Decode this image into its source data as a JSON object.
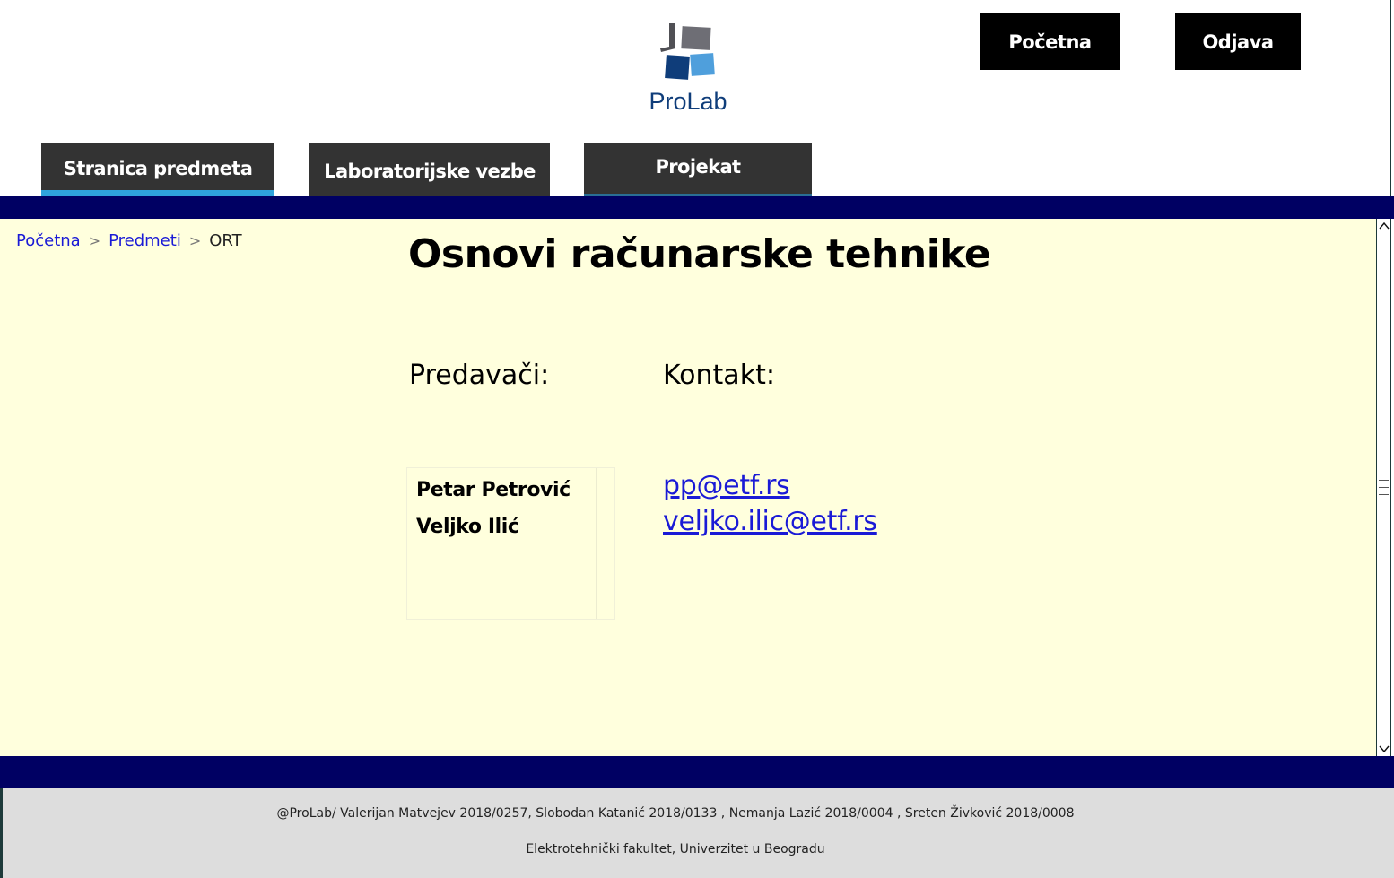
{
  "header": {
    "logo_text": "ProLab",
    "pocetna_button": "Početna",
    "odjava_button": "Odjava"
  },
  "tabs": [
    {
      "label": "Stranica predmeta",
      "active": true
    },
    {
      "label": "Laboratorijske vezbe",
      "active": false
    },
    {
      "label": "Projekat",
      "active": false
    }
  ],
  "breadcrumb": {
    "items": [
      "Početna",
      "Predmeti",
      "ORT"
    ],
    "separator": ">"
  },
  "main": {
    "title": "Osnovi računarske tehnike",
    "lecturers_heading": "Predavači:",
    "contact_heading": "Kontakt:",
    "lecturers": [
      {
        "name": "Petar Petrović",
        "email": "pp@etf.rs"
      },
      {
        "name": "Veljko Ilić",
        "email": "veljko.ilic@etf.rs"
      }
    ]
  },
  "footer": {
    "credits": "@ProLab/ Valerijan Matvejev 2018/0257, Slobodan Katanić 2018/0133 , Nemanja Lazić 2018/0004 , Sreten Živković 2018/0008",
    "institution": "Elektrotehnički fakultet, Univerzitet u Beogradu"
  },
  "colors": {
    "stripe": "#000063",
    "content_bg": "#ffffdd",
    "active_tab_underline": "#2fa3dc",
    "link": "#1a1ad6",
    "logo_dark_blue": "#0f3d7a",
    "logo_light_blue": "#4f9fdc",
    "logo_gray": "#6e6e75"
  },
  "icons": {
    "logo": "prolab-logo-icon",
    "scroll_up": "chevron-up-icon",
    "scroll_down": "chevron-down-icon"
  }
}
